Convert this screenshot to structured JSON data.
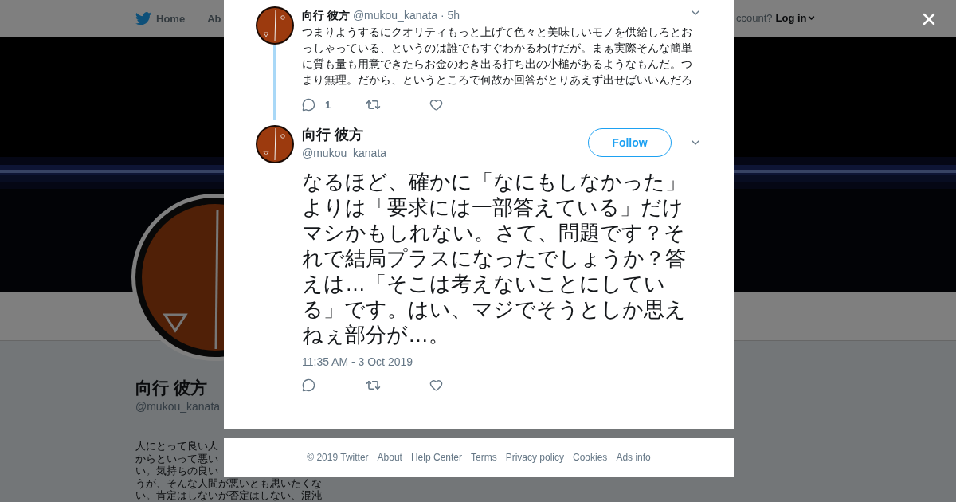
{
  "nav": {
    "home": "Home",
    "about": "Ab",
    "account_prompt": "ccount?",
    "login": "Log in"
  },
  "profile": {
    "name": "向行 彼方",
    "handle": "@mukou_kanata",
    "bio_lines": [
      "人にとって良い人",
      "からといって悪い",
      "い。気持ちの良い",
      "うが、そんな人間が悪いとも思いたくな",
      "い。肯定はしないが否定はしない、混沌"
    ]
  },
  "thread": [
    {
      "name": "向行 彼方",
      "handle": "@mukou_kanata",
      "time": "· 5h",
      "text": "つまりようするにクオリティもっと上げて色々と美味しいモノを供給しろとおっしゃっている、というのは誰でもすぐわかるわけだが。まぁ実際そんな簡単に質も量も用意できたらお金のわき出る打ち出の小槌があるようなもんだ。つまり無理。だから、というところで何故か回答がとりあえず出せばいいんだろ",
      "replies": "1"
    }
  ],
  "tweet": {
    "name": "向行 彼方",
    "handle": "@mukou_kanata",
    "follow": "Follow",
    "text": "なるほど、確かに「なにもしなかった」よりは「要求には一部答えている」だけマシかもしれない。さて、問題です？それで結局プラスになったでしょうか？答えは…「そこは考えないことにしている」です。はい、マジでそうとしか思えねぇ部分が…。",
    "timestamp": "11:35 AM - 3 Oct 2019"
  },
  "footer": {
    "links": [
      "© 2019 Twitter",
      "About",
      "Help Center",
      "Terms",
      "Privacy policy",
      "Cookies",
      "Ads info"
    ]
  }
}
